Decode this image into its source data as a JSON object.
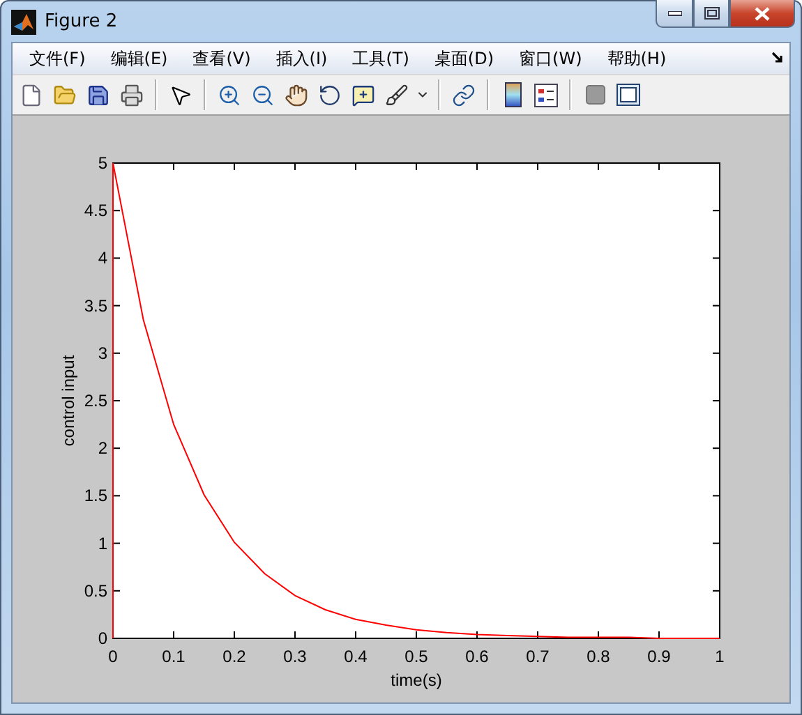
{
  "window": {
    "title": "Figure 2"
  },
  "menu": [
    {
      "label": "文件(F)"
    },
    {
      "label": "编辑(E)"
    },
    {
      "label": "查看(V)"
    },
    {
      "label": "插入(I)"
    },
    {
      "label": "工具(T)"
    },
    {
      "label": "桌面(D)"
    },
    {
      "label": "窗口(W)"
    },
    {
      "label": "帮助(H)"
    }
  ],
  "toolbar": [
    {
      "kind": "new"
    },
    {
      "kind": "open"
    },
    {
      "kind": "save"
    },
    {
      "kind": "print"
    },
    {
      "kind": "separator"
    },
    {
      "kind": "pointer"
    },
    {
      "kind": "separator"
    },
    {
      "kind": "zoom_in"
    },
    {
      "kind": "zoom_out"
    },
    {
      "kind": "pan"
    },
    {
      "kind": "rotate"
    },
    {
      "kind": "data_cursor"
    },
    {
      "kind": "brush"
    },
    {
      "kind": "dropdown"
    },
    {
      "kind": "separator"
    },
    {
      "kind": "link"
    },
    {
      "kind": "separator"
    },
    {
      "kind": "colorbar"
    },
    {
      "kind": "legend"
    },
    {
      "kind": "separator"
    },
    {
      "kind": "hide_tools"
    },
    {
      "kind": "show_tools"
    }
  ],
  "chart_data": {
    "type": "line",
    "xlabel": "time(s)",
    "ylabel": "control input",
    "xlim": [
      0,
      1
    ],
    "ylim": [
      0,
      5
    ],
    "xticks": [
      {
        "value": 0,
        "label": "0"
      },
      {
        "value": 0.1,
        "label": "0.1"
      },
      {
        "value": 0.2,
        "label": "0.2"
      },
      {
        "value": 0.3,
        "label": "0.3"
      },
      {
        "value": 0.4,
        "label": "0.4"
      },
      {
        "value": 0.5,
        "label": "0.5"
      },
      {
        "value": 0.6,
        "label": "0.6"
      },
      {
        "value": 0.7,
        "label": "0.7"
      },
      {
        "value": 0.8,
        "label": "0.8"
      },
      {
        "value": 0.9,
        "label": "0.9"
      },
      {
        "value": 1,
        "label": "1"
      }
    ],
    "yticks": [
      {
        "value": 0,
        "label": "0"
      },
      {
        "value": 0.5,
        "label": "0.5"
      },
      {
        "value": 1,
        "label": "1"
      },
      {
        "value": 1.5,
        "label": "1.5"
      },
      {
        "value": 2,
        "label": "2"
      },
      {
        "value": 2.5,
        "label": "2.5"
      },
      {
        "value": 3,
        "label": "3"
      },
      {
        "value": 3.5,
        "label": "3.5"
      },
      {
        "value": 4,
        "label": "4"
      },
      {
        "value": 4.5,
        "label": "4.5"
      },
      {
        "value": 5,
        "label": "5"
      }
    ],
    "x": [
      0,
      0,
      0.05,
      0.1,
      0.15,
      0.2,
      0.25,
      0.3,
      0.35,
      0.4,
      0.45,
      0.5,
      0.55,
      0.6,
      0.65,
      0.7,
      0.75,
      0.8,
      0.85,
      0.9,
      0.95,
      1
    ],
    "series": [
      {
        "color": "#ff0000",
        "values": [
          0,
          5,
          3.35,
          2.25,
          1.51,
          1.01,
          0.68,
          0.45,
          0.3,
          0.2,
          0.14,
          0.09,
          0.06,
          0.04,
          0.03,
          0.02,
          0.01,
          0.01,
          0.01,
          0,
          0,
          0
        ]
      }
    ]
  }
}
